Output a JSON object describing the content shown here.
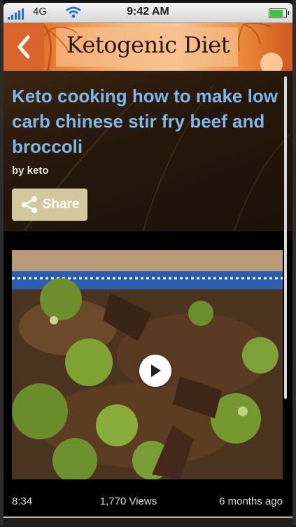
{
  "status_bar": {
    "network": "4G",
    "time": "9:42 AM",
    "battery_level": 0.9
  },
  "header": {
    "title": "Ketogenic Diet",
    "back_icon": "chevron-left-icon"
  },
  "article": {
    "title": "Keto cooking how to make low carb chinese stir fry beef and broccoli",
    "byline": "by keto",
    "share_label": "Share",
    "share_icon": "share-icon"
  },
  "video": {
    "duration": "8:34",
    "views": "1,770 Views",
    "age": "6 months ago",
    "play_icon": "play-icon"
  },
  "colors": {
    "title_blue": "#7fb6e8",
    "share_button": "#d5c79d",
    "header_orange": "#ed7d2f"
  }
}
